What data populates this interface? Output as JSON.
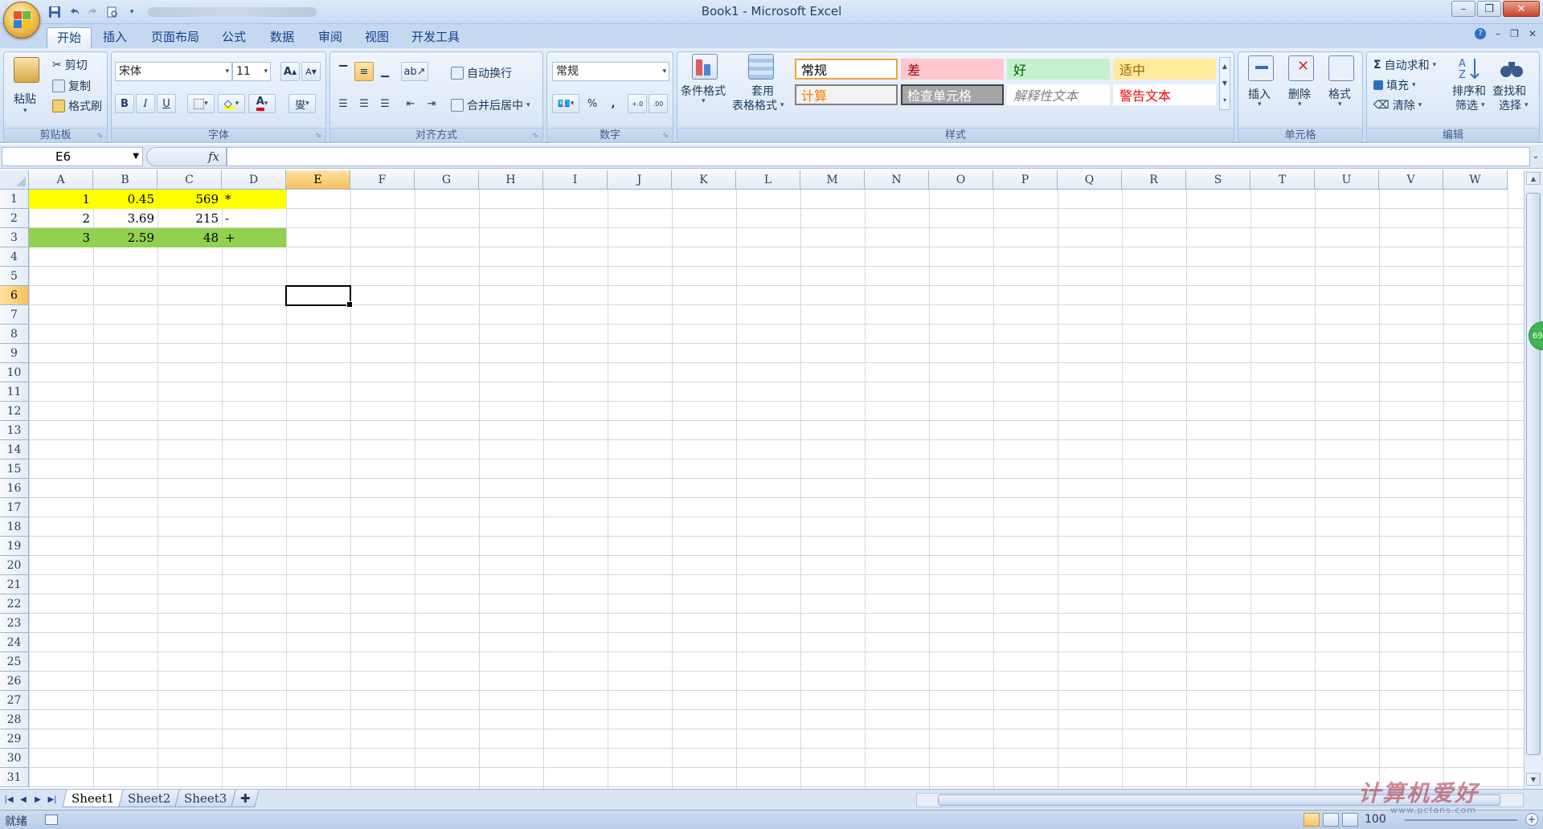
{
  "window": {
    "title": "Book1 - Microsoft Excel"
  },
  "tabs": [
    "开始",
    "插入",
    "页面布局",
    "公式",
    "数据",
    "审阅",
    "视图",
    "开发工具"
  ],
  "ribbon": {
    "clipboard": {
      "label": "剪贴板",
      "paste": "粘贴",
      "cut": "剪切",
      "copy": "复制",
      "format_painter": "格式刷"
    },
    "font": {
      "label": "字体",
      "font_name": "宋体",
      "font_size": "11",
      "bold": "B",
      "italic": "I",
      "underline": "U",
      "grow": "A",
      "shrink": "A",
      "font_color_glyph": "A",
      "phonetic": "燮"
    },
    "alignment": {
      "label": "对齐方式",
      "wrap": "自动换行",
      "merge": "合并后居中"
    },
    "number": {
      "label": "数字",
      "format": "常规",
      "percent": "%",
      "comma": ",",
      "inc_decimal": "+.0",
      "dec_decimal": ".00"
    },
    "styles": {
      "label": "样式",
      "conditional": "条件格式",
      "table_line1": "套用",
      "table_line2": "表格格式",
      "cells": [
        {
          "text": "常规",
          "bg": "#ffffff",
          "color": "#000000",
          "border": "#f2a23a"
        },
        {
          "text": "差",
          "bg": "#ffc7ce",
          "color": "#9c0006",
          "border": "#ffc7ce"
        },
        {
          "text": "好",
          "bg": "#c6efce",
          "color": "#006100",
          "border": "#c6efce"
        },
        {
          "text": "适中",
          "bg": "#ffeb9c",
          "color": "#9c6500",
          "border": "#ffeb9c"
        },
        {
          "text": "计算",
          "bg": "#f2f2f2",
          "color": "#fa7d00",
          "border": "#7f7f7f"
        },
        {
          "text": "检查单元格",
          "bg": "#a5a5a5",
          "color": "#ffffff",
          "border": "#3f3f3f"
        },
        {
          "text": "解释性文本",
          "bg": "#ffffff",
          "color": "#7f7f7f",
          "border": "#ffffff"
        },
        {
          "text": "警告文本",
          "bg": "#ffffff",
          "color": "#ff0000",
          "border": "#ffffff"
        }
      ]
    },
    "cells_group": {
      "label": "单元格",
      "insert": "插入",
      "delete": "删除",
      "format": "格式"
    },
    "editing": {
      "label": "编辑",
      "autosum": "自动求和",
      "fill": "填充",
      "clear": "清除",
      "sort_line1": "排序和",
      "sort_line2": "筛选",
      "find_line1": "查找和",
      "find_line2": "选择"
    }
  },
  "formula_bar": {
    "name_box": "E6",
    "fx": "fx",
    "content": ""
  },
  "sheet": {
    "columns": [
      "A",
      "B",
      "C",
      "D",
      "E",
      "F",
      "G",
      "H",
      "I",
      "J",
      "K",
      "L",
      "M",
      "N",
      "O",
      "P",
      "Q",
      "R",
      "S",
      "T",
      "U",
      "V",
      "W"
    ],
    "row_count": 31,
    "selected_column": "E",
    "selected_row": 6,
    "rows": [
      {
        "fill": "#ffff00",
        "a": "1",
        "b": "0.45",
        "c": "569",
        "d": "*"
      },
      {
        "fill": "#ffffff",
        "a": "2",
        "b": "3.69",
        "c": "215",
        "d": "-"
      },
      {
        "fill": "#92d050",
        "a": "3",
        "b": "2.59",
        "c": "48",
        "d": "+"
      }
    ]
  },
  "sheet_tabs": [
    "Sheet1",
    "Sheet2",
    "Sheet3"
  ],
  "status": {
    "ready": "就绪",
    "zoom": "100"
  },
  "watermark": {
    "main": "计算机爱好",
    "sub": "www.pcfans.com"
  },
  "icons": [
    "office-button",
    "save-icon",
    "undo-icon",
    "redo-icon",
    "print-preview-icon",
    "help-icon",
    "minimize-icon",
    "maximize-icon",
    "close-icon"
  ]
}
